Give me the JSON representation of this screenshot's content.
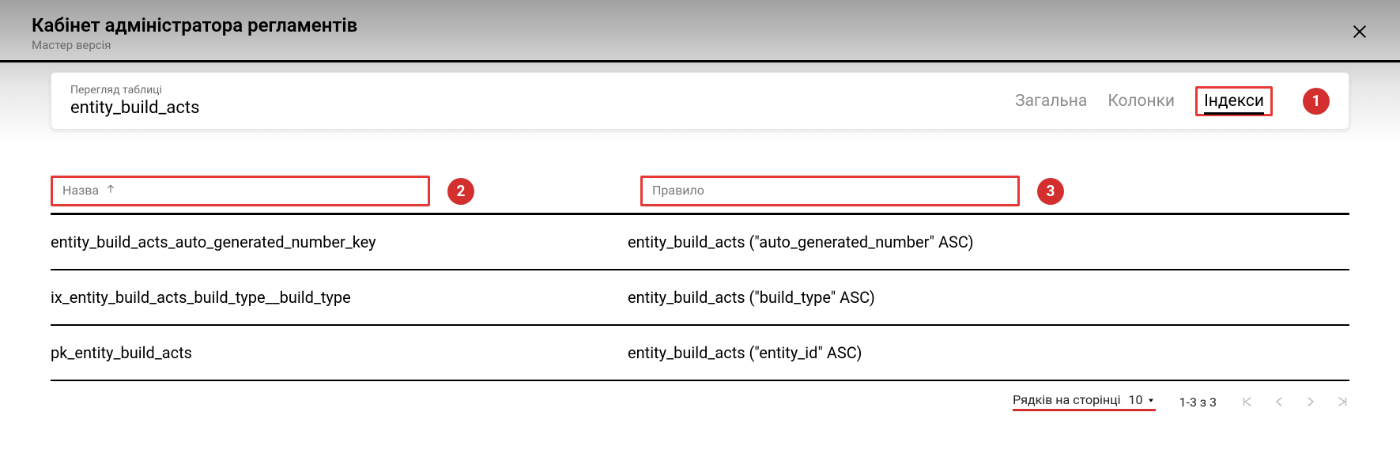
{
  "header": {
    "title": "Кабінет адміністратора регламентів",
    "subtitle": "Мастер версія"
  },
  "card": {
    "label": "Перегляд таблиці",
    "value": "entity_build_acts"
  },
  "tabs": {
    "items": [
      {
        "label": "Загальна",
        "active": false
      },
      {
        "label": "Колонки",
        "active": false
      },
      {
        "label": "Індекси",
        "active": true
      }
    ]
  },
  "filters": {
    "name_label": "Назва",
    "rule_label": "Правило"
  },
  "callouts": {
    "one": "1",
    "two": "2",
    "three": "3"
  },
  "rows": [
    {
      "name": "entity_build_acts_auto_generated_number_key",
      "rule": "entity_build_acts (\"auto_generated_number\" ASC)"
    },
    {
      "name": "ix_entity_build_acts_build_type__build_type",
      "rule": "entity_build_acts (\"build_type\" ASC)"
    },
    {
      "name": "pk_entity_build_acts",
      "rule": "entity_build_acts (\"entity_id\" ASC)"
    }
  ],
  "pagination": {
    "rows_label": "Рядків на сторінці",
    "rows_value": "10",
    "range": "1-3 з 3"
  }
}
